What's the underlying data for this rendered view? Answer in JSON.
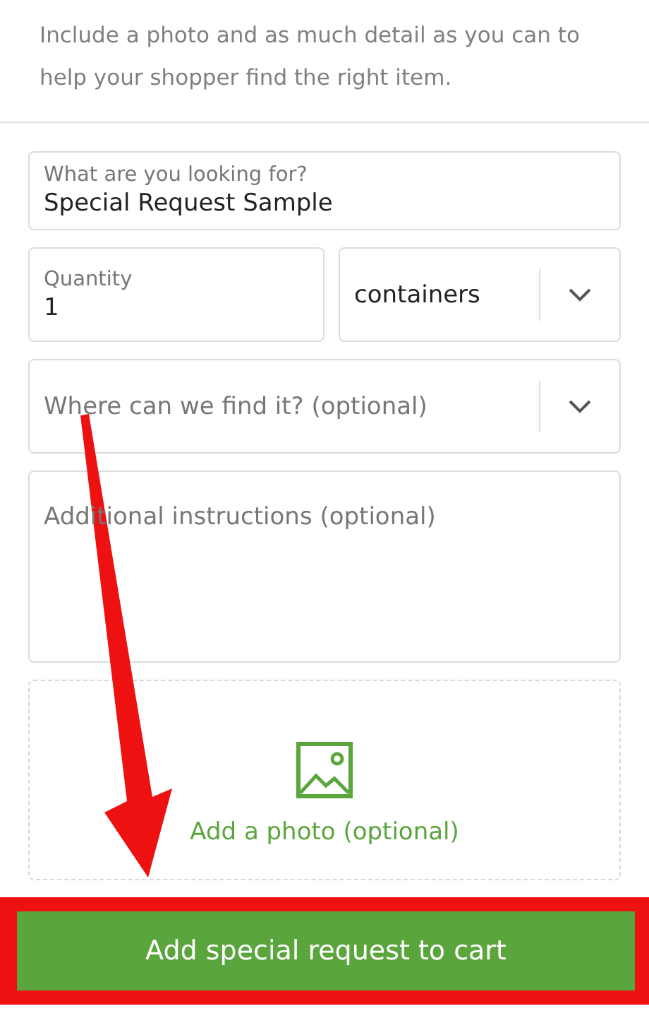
{
  "intro": "Include a photo and as much detail as you can to help your shopper find the right item.",
  "item_field": {
    "label": "What are you looking for?",
    "value": "Special Request Sample"
  },
  "quantity_field": {
    "label": "Quantity",
    "value": "1"
  },
  "unit_select": {
    "value": "containers"
  },
  "location_select": {
    "placeholder": "Where can we find it? (optional)"
  },
  "instructions_field": {
    "placeholder": "Additional instructions (optional)"
  },
  "photo_upload": {
    "label": "Add a photo (optional)"
  },
  "submit_button": {
    "label": "Add special request to cart",
    "highlighted": true
  },
  "annotation_arrow": {
    "shown": true
  }
}
